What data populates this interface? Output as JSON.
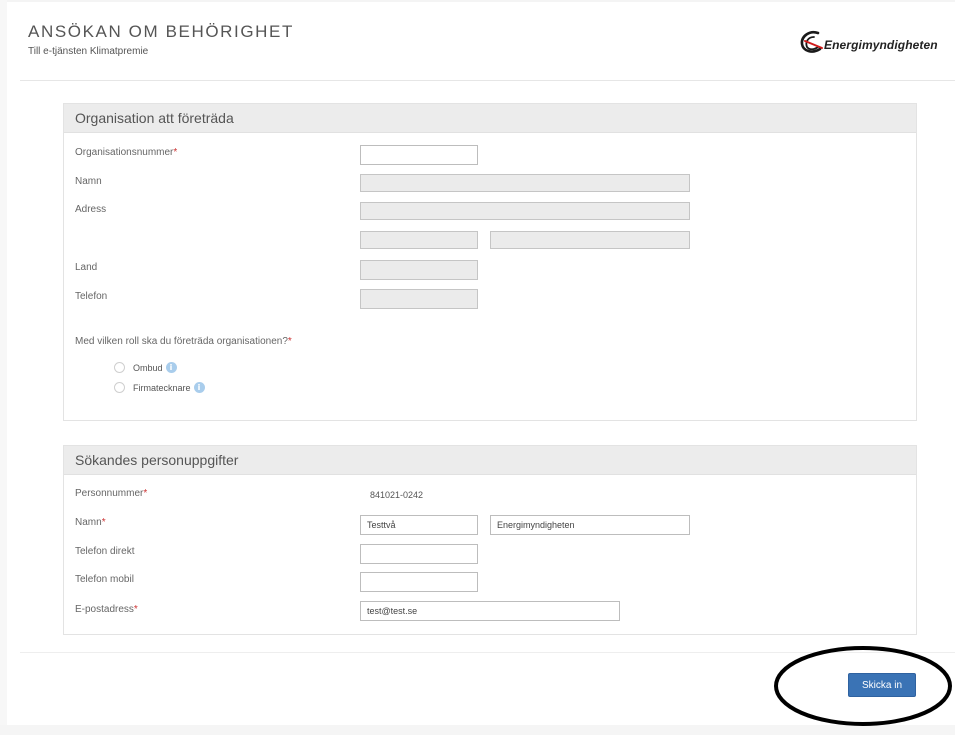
{
  "header": {
    "title": "ANSÖKAN OM BEHÖRIGHET",
    "subtitle": "Till e-tjänsten Klimatpremie",
    "logo_text": "Energimyndigheten"
  },
  "organisation": {
    "heading": "Organisation att företräda",
    "orgnr_label": "Organisationsnummer",
    "required_mark": "*",
    "orgnr_value": "",
    "name_label": "Namn",
    "address_label": "Adress",
    "country_label": "Land",
    "phone_label": "Telefon",
    "role_question": "Med vilken roll ska du företräda organisationen?",
    "roles": [
      {
        "label": "Ombud"
      },
      {
        "label": "Firmatecknare"
      }
    ],
    "info_glyph": "i"
  },
  "applicant": {
    "heading": "Sökandes personuppgifter",
    "personnummer_label": "Personnummer",
    "personnummer_value": "841021-0242",
    "name_label": "Namn",
    "first_name_value": "Testtvå",
    "last_name_value": "Energimyndigheten",
    "phone_direct_label": "Telefon direkt",
    "phone_direct_value": "",
    "phone_mobile_label": "Telefon mobil",
    "phone_mobile_value": "",
    "email_label": "E-postadress",
    "email_value": "test@test.se",
    "required_mark": "*"
  },
  "actions": {
    "submit_label": "Skicka in"
  },
  "colors": {
    "button": "#3a73b5",
    "section_header": "#ececec",
    "disabled_field": "#ebebeb",
    "required": "#cc3333",
    "info_icon": "#a9cdec"
  }
}
